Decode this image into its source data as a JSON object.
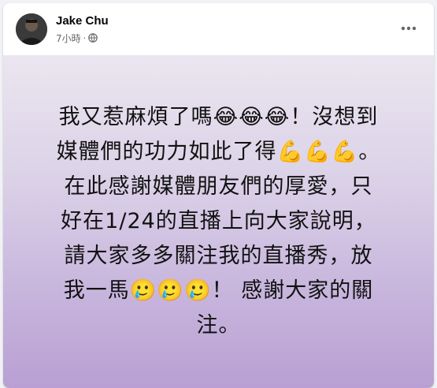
{
  "post": {
    "author": "Jake Chu",
    "time": "7小時",
    "separator": "·",
    "audience_icon": "globe-icon",
    "more_icon": "more-horizontal-icon",
    "text": "我又惹麻煩了嗎😂😂😂！沒想到\n媒體們的功力如此了得💪💪💪。\n在此感謝媒體朋友們的厚愛，只\n好在1/24的直播上向大家說明，\n請大家多多關注我的直播秀，放\n我一馬🥲🥲🥲！ 感謝大家的關\n注。"
  },
  "colors": {
    "background_top": "#ebe6f0",
    "background_bottom": "#b99fd3",
    "text": "#111111",
    "meta": "#65676b"
  }
}
